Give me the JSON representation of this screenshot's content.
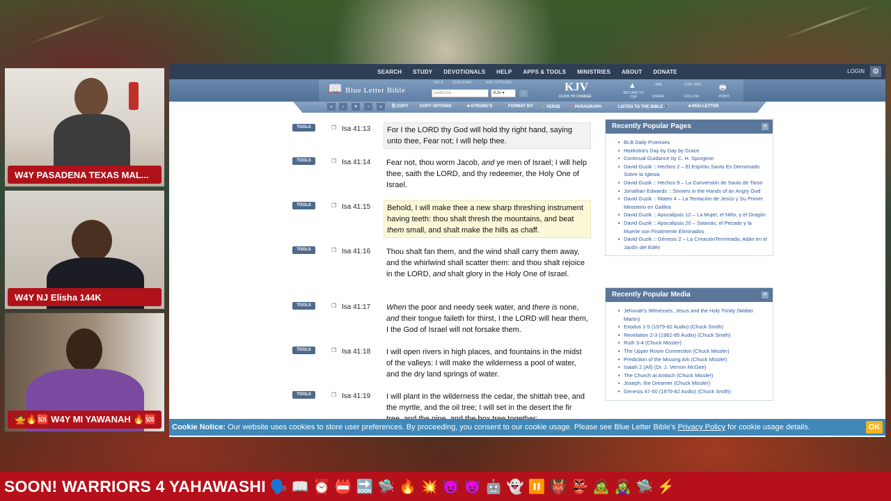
{
  "cams": [
    {
      "label": "W4Y PASADENA TEXAS MAL..."
    },
    {
      "label": "W4Y NJ Elisha 144K"
    },
    {
      "label": "🙅🔥🆘 W4Y MI YAWANAH 🔥🆘"
    }
  ],
  "nav": {
    "items": [
      "SEARCH",
      "STUDY",
      "DEVOTIONALS",
      "HELP",
      "APPS & TOOLS",
      "MINISTRIES",
      "ABOUT",
      "DONATE"
    ],
    "login": "LOGIN"
  },
  "header": {
    "logo": "Blue Letter Bible",
    "help_label": "HELP",
    "quicknav_label": "QUICKNAV",
    "nav_options_label": "NAV OPTIONS",
    "search_value": "jawhrone",
    "version": "KJV",
    "kjv_big": "KJV",
    "kjv_sub": "CLICK TO CHANGE",
    "return_top": "RETURN TO TOP",
    "link": "LINK",
    "cite_this": "CITE THIS",
    "share": "SHARE",
    "follow": "FOLLOW",
    "print": "PRINT"
  },
  "toolbar": {
    "copy": "COPY",
    "copy_options": "COPY OPTIONS",
    "strongs": "STRONG'S",
    "format_by": "FORMAT BY:",
    "verse": "VERSE",
    "paragraph": "PARAGRAPH",
    "listen": "LISTEN TO THE BIBLE",
    "red_letter": "RED-LETTER"
  },
  "tools_label": "TOOLS",
  "verses": [
    {
      "ref": "Isa 41:13",
      "html": "For I the LORD thy God will hold thy right hand, saying unto thee, Fear not; I will help thee.",
      "hl": "gray"
    },
    {
      "ref": "Isa 41:14",
      "html": "Fear not, thou worm Jacob, <i>and</i> ye men of Israel; I will help thee, saith the LORD, and thy redeemer, the Holy One of Israel.",
      "hl": ""
    },
    {
      "ref": "Isa 41:15",
      "html": "Behold, I will make thee a new sharp threshing instrument having teeth: thou shalt thresh the mountains, and beat <i>them</i> small, and shalt make the hills as chaff.",
      "hl": "yellow"
    },
    {
      "ref": "Isa 41:16",
      "html": "Thou shalt fan them, and the wind shall carry them away, and the whirlwind shall scatter them: and thou shalt rejoice in the LORD, <i>and</i> shalt glory in the Holy One of Israel.",
      "hl": ""
    },
    {
      "ref": "Isa 41:17",
      "html": "<i>When</i> the poor and needy seek water, and <i>there is</i> none, <i>and</i> their tongue faileth for thirst, I the LORD will hear them, I the God of Israel will not forsake them.",
      "hl": ""
    },
    {
      "ref": "Isa 41:18",
      "html": "I will open rivers in high places, and fountains in the midst of the valleys: I will make the wilderness a pool of water, and the dry land springs of water.",
      "hl": ""
    },
    {
      "ref": "Isa 41:19",
      "html": "I will plant in the wilderness the cedar, the shittah tree, and the myrtle, and the oil tree; I will set in the desert the fir tree, and the pine, and the box tree together:",
      "hl": ""
    }
  ],
  "popular_pages": {
    "title": "Recently Popular Pages",
    "items": [
      "BLB Daily Promises",
      "Hoekstra's Day by Day by Grace",
      "Continual Guidance by C. H. Spurgeon",
      "David Guzik :: Hechos 2 – El Espíritu Santo Es Derramado Sobre la Iglesia",
      "David Guzik :: Hechos 9 – La Conversión de Saulo de Tarso",
      "Jonathan Edwards :: Sinners in the Hands of an Angry God",
      "David Guzik :: Mateo 4 – La Tentación de Jesús y Su Primer Ministerio en Galilea",
      "David Guzik :: Apocalipsis 12 – La Mujer, el Niño, y el Dragón",
      "David Guzik :: Apocalipsis 20 – Satanás, el Pecado y la Muerte son Finalmente Eliminados",
      "David Guzik :: Génesis 2 – La CreaciónTerminada; Adán en el Jardín del Edén"
    ]
  },
  "popular_media": {
    "title": "Recently Popular Media",
    "items": [
      "Jehovah's Witnesses, Jesus and the Holy Trinity (Walter Martin)",
      "Exodus 1-5 (1979-82 Audio) (Chuck Smith)",
      "Revelation 2-3 (1982-85 Audio) (Chuck Smith)",
      "Ruth 3-4 (Chuck Missler)",
      "The Upper Room Connection (Chuck Missler)",
      "Prediction of the Missing Ark (Chuck Missler)",
      "Isaiah 2 (All) (Dr. J. Vernon McGee)",
      "The Church at Antioch (Chuck Missler)",
      "Joseph, the Dreamer (Chuck Missler)",
      "Genesis 47-50 (1979-82 Audio) (Chuck Smith)"
    ]
  },
  "cookie": {
    "label": "Cookie Notice:",
    "text": " Our website uses cookies to store user preferences. By proceeding, you consent to our cookie usage. Please see Blue Letter Bible's ",
    "link": "Privacy Policy",
    "tail": " for cookie usage details.",
    "ok": "OK"
  },
  "ticker": {
    "text": "SOON! WARRIORS 4 YAHAWASHI",
    "emojis": [
      "🗣️",
      "📖",
      "⏰",
      "📛",
      "🔜",
      "🛸",
      "🔥",
      "💥",
      "😈",
      "👿",
      "🤖",
      "👻",
      "⏸️",
      "👹",
      "👺",
      "🧟",
      "🧟‍♀️",
      "🛸",
      "⚡"
    ]
  }
}
